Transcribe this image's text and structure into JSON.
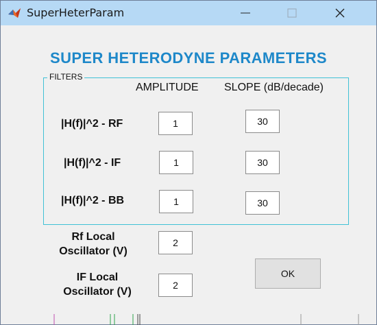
{
  "window": {
    "title": "SuperHeterParam",
    "app_icon": "matlab-icon",
    "controls": {
      "minimize": "minimize-icon",
      "maximize": "maximize-icon",
      "close": "close-icon"
    }
  },
  "heading": "SUPER HETERODYNE PARAMETERS",
  "filters": {
    "group_label": "FILTERS",
    "col_amplitude": "AMPLITUDE",
    "col_slope": "SLOPE (dB/decade)",
    "rows": [
      {
        "label": "|H(f)|^2 - RF",
        "amplitude": "1",
        "slope": "30"
      },
      {
        "label": "|H(f)|^2 - IF",
        "amplitude": "1",
        "slope": "30"
      },
      {
        "label": "|H(f)|^2 - BB",
        "amplitude": "1",
        "slope": "30"
      }
    ]
  },
  "oscillators": {
    "rf": {
      "line1": "Rf Local",
      "line2": "Oscillator (V)",
      "value": "2"
    },
    "if": {
      "line1": "IF Local",
      "line2": "Oscillator (V)",
      "value": "2"
    }
  },
  "ok_label": "OK",
  "colors": {
    "titlebar": "#b6d9f5",
    "heading": "#1e88c9",
    "frame": "#3fc1d6"
  }
}
